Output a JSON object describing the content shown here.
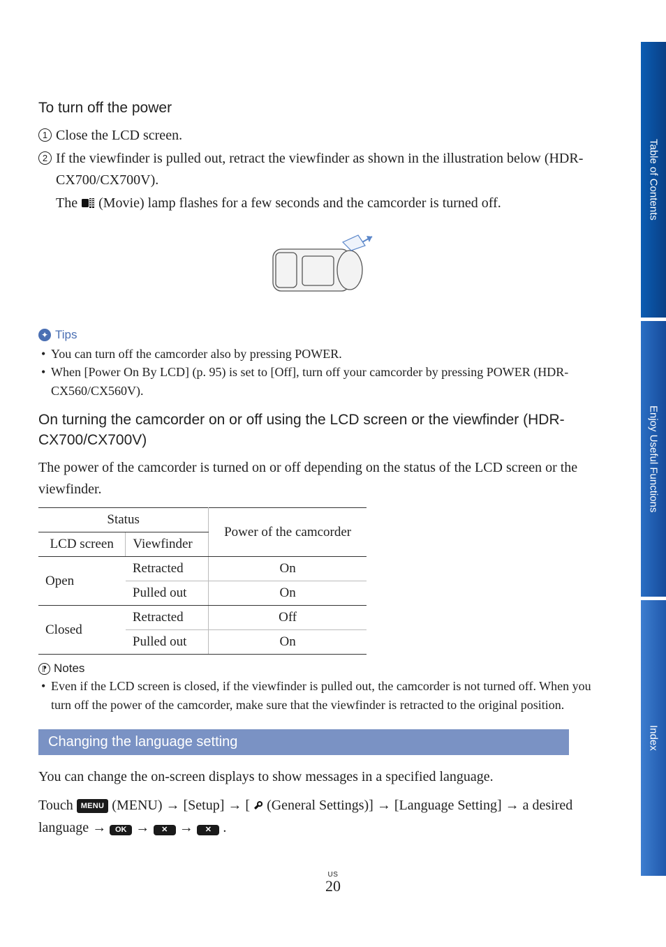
{
  "headings": {
    "toTurnOff": "To turn off the power",
    "onTurning": "On turning the camcorder on or off using the LCD screen or the viewfinder (HDR-CX700/CX700V)"
  },
  "steps": {
    "s1": "Close the LCD screen.",
    "s2": "If the viewfinder is pulled out, retract the viewfinder as shown in the illustration below (HDR-CX700/CX700V).",
    "lampLine_a": "The ",
    "lampLine_b": " (Movie) lamp flashes for a few seconds and the camcorder is turned off."
  },
  "tips": {
    "label": "Tips",
    "t1": "You can turn off the camcorder also by pressing POWER.",
    "t2": "When [Power On By LCD] (p. 95) is set to [Off], turn off your camcorder by pressing POWER (HDR-CX560/CX560V)."
  },
  "para1": "The power of the camcorder is turned on or off depending on the status of the LCD screen or the viewfinder.",
  "table": {
    "h_status": "Status",
    "h_power": "Power of the camcorder",
    "h_lcd": "LCD screen",
    "h_vf": "Viewfinder",
    "rows": [
      {
        "lcd": "Open",
        "vf": "Retracted",
        "power": "On"
      },
      {
        "lcd": "",
        "vf": "Pulled out",
        "power": "On"
      },
      {
        "lcd": "Closed",
        "vf": "Retracted",
        "power": "Off"
      },
      {
        "lcd": "",
        "vf": "Pulled out",
        "power": "On"
      }
    ]
  },
  "notes": {
    "label": "Notes",
    "n1": "Even if the LCD screen is closed, if the viewfinder is pulled out, the camcorder is not turned off. When you turn off the power of the camcorder, make sure that the viewfinder is retracted to the original position."
  },
  "section": {
    "title": "Changing the language setting",
    "p1": "You can change the on-screen displays to show messages in a specified language.",
    "p2_a": "Touch ",
    "p2_menu": "MENU",
    "p2_b": " (MENU) ",
    "p2_c": " [Setup] ",
    "p2_d": " (General Settings)] ",
    "p2_d_prefix": " [",
    "p2_e": " [Language Setting] ",
    "p2_f": " a desired language ",
    "ok": "OK",
    "x": "✕"
  },
  "sidebar": {
    "toc": "Table of Contents",
    "useful": "Enjoy Useful Functions",
    "index": "Index"
  },
  "footer": {
    "region": "US",
    "page": "20"
  }
}
